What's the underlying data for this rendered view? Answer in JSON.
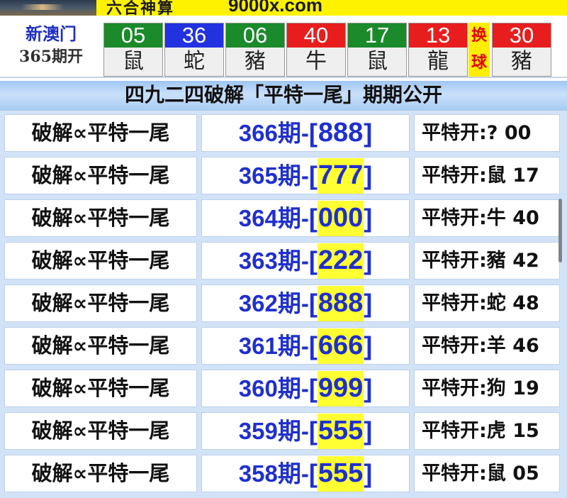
{
  "banner": {
    "scribble": "六合神算",
    "url": "9000x.com"
  },
  "draw": {
    "region": "新澳门",
    "issue": "365期开",
    "balls": [
      {
        "number": "05",
        "zodiac": "鼠",
        "color": "#1a8a2a"
      },
      {
        "number": "36",
        "zodiac": "蛇",
        "color": "#2232e0"
      },
      {
        "number": "06",
        "zodiac": "豬",
        "color": "#1a8a2a"
      },
      {
        "number": "40",
        "zodiac": "牛",
        "color": "#e81e1e"
      },
      {
        "number": "17",
        "zodiac": "鼠",
        "color": "#1a8a2a"
      },
      {
        "number": "13",
        "zodiac": "龍",
        "color": "#e81e1e"
      }
    ],
    "swap_label_1": "换",
    "swap_label_2": "球",
    "special": {
      "number": "30",
      "zodiac": "豬",
      "color": "#e81e1e"
    }
  },
  "header": {
    "title": "四九二四破解「平特一尾」期期公开"
  },
  "rows": [
    {
      "label": "破解∝平特一尾",
      "issue": "366期-",
      "code": "888",
      "highlight": false,
      "result": "平特开:?  00"
    },
    {
      "label": "破解∝平特一尾",
      "issue": "365期-",
      "code": "777",
      "highlight": true,
      "result": "平特开:鼠 17"
    },
    {
      "label": "破解∝平特一尾",
      "issue": "364期-",
      "code": "000",
      "highlight": true,
      "result": "平特开:牛 40"
    },
    {
      "label": "破解∝平特一尾",
      "issue": "363期-",
      "code": "222",
      "highlight": true,
      "result": "平特开:豬 42"
    },
    {
      "label": "破解∝平特一尾",
      "issue": "362期-",
      "code": "888",
      "highlight": true,
      "result": "平特开:蛇 48"
    },
    {
      "label": "破解∝平特一尾",
      "issue": "361期-",
      "code": "666",
      "highlight": true,
      "result": "平特开:羊 46"
    },
    {
      "label": "破解∝平特一尾",
      "issue": "360期-",
      "code": "999",
      "highlight": true,
      "result": "平特开:狗 19"
    },
    {
      "label": "破解∝平特一尾",
      "issue": "359期-",
      "code": "555",
      "highlight": true,
      "result": "平特开:虎 15"
    },
    {
      "label": "破解∝平特一尾",
      "issue": "358期-",
      "code": "555",
      "highlight": true,
      "result": "平特开:鼠 05"
    }
  ]
}
